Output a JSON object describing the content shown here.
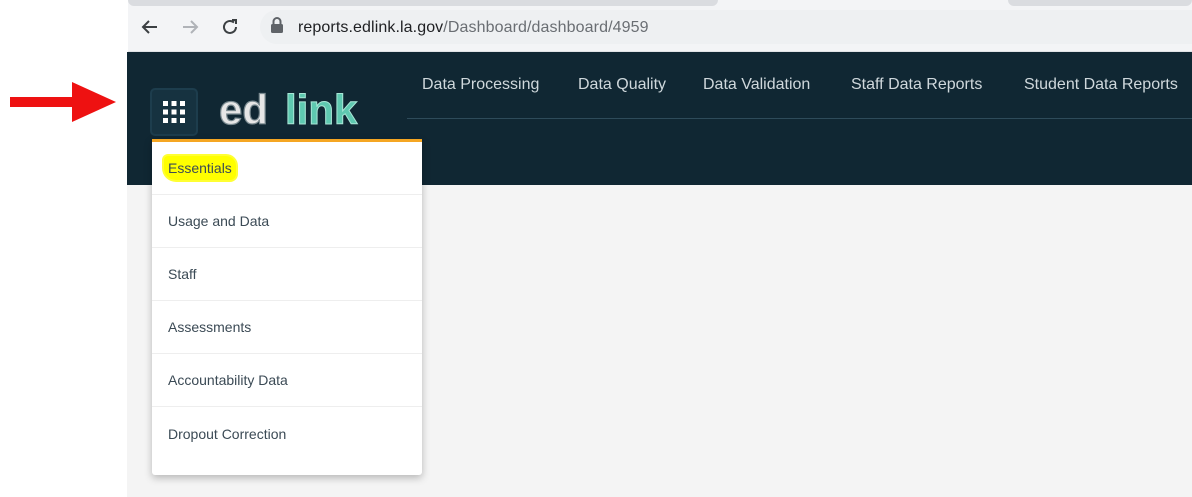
{
  "browser": {
    "url_host": "reports.edlink.la.gov",
    "url_path": "/Dashboard/dashboard/4959",
    "icons": [
      "back-arrow-icon",
      "forward-arrow-icon",
      "reload-icon",
      "lock-icon"
    ]
  },
  "header": {
    "logo_text_a": "ed",
    "logo_text_b": "link",
    "nav": [
      {
        "label": "Data Processing"
      },
      {
        "label": "Data Quality"
      },
      {
        "label": "Data Validation"
      },
      {
        "label": "Staff Data Reports"
      },
      {
        "label": "Student Data Reports"
      }
    ],
    "menu_icon": "grid-icon"
  },
  "dropdown": {
    "items": [
      {
        "label": "Essentials",
        "highlighted": true
      },
      {
        "label": "Usage and Data"
      },
      {
        "label": "Staff"
      },
      {
        "label": "Assessments"
      },
      {
        "label": "Accountability Data"
      },
      {
        "label": "Dropout Correction"
      }
    ]
  },
  "annotation": {
    "arrow_color": "#ee1111",
    "highlight_color": "#ffff00"
  },
  "colors": {
    "header_bg": "#102733",
    "accent_teal": "#5ec9b0",
    "accent_orange": "#f5a623",
    "content_bg": "#f4f4f4"
  }
}
